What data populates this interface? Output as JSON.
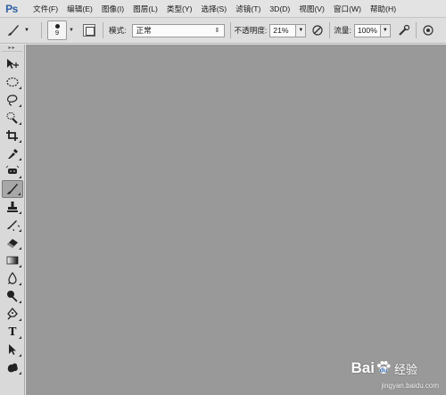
{
  "app": {
    "logo": "Ps"
  },
  "menubar": {
    "items": [
      {
        "label": "文件(F)"
      },
      {
        "label": "编辑(E)"
      },
      {
        "label": "图像(I)"
      },
      {
        "label": "图层(L)"
      },
      {
        "label": "类型(Y)"
      },
      {
        "label": "选择(S)"
      },
      {
        "label": "滤镜(T)"
      },
      {
        "label": "3D(D)"
      },
      {
        "label": "视图(V)"
      },
      {
        "label": "窗口(W)"
      },
      {
        "label": "帮助(H)"
      }
    ]
  },
  "options": {
    "brush_size": "9",
    "mode_label": "模式:",
    "mode_value": "正常",
    "opacity_label": "不透明度:",
    "opacity_value": "21%",
    "flow_label": "流量:",
    "flow_value": "100%"
  },
  "toolbox": {
    "tools": [
      {
        "name": "move-tool",
        "icon": "move-icon"
      },
      {
        "name": "marquee-tool",
        "icon": "ellipse-marquee-icon"
      },
      {
        "name": "lasso-tool",
        "icon": "lasso-icon"
      },
      {
        "name": "quick-select-tool",
        "icon": "quick-select-icon"
      },
      {
        "name": "crop-tool",
        "icon": "crop-icon"
      },
      {
        "name": "eyedropper-tool",
        "icon": "eyedropper-icon"
      },
      {
        "name": "spot-healing-tool",
        "icon": "spot-healing-icon"
      },
      {
        "name": "brush-tool",
        "icon": "brush-icon",
        "active": true
      },
      {
        "name": "clone-stamp-tool",
        "icon": "clone-stamp-icon"
      },
      {
        "name": "history-brush-tool",
        "icon": "history-brush-icon"
      },
      {
        "name": "eraser-tool",
        "icon": "eraser-icon"
      },
      {
        "name": "gradient-tool",
        "icon": "gradient-icon"
      },
      {
        "name": "blur-tool",
        "icon": "blur-icon"
      },
      {
        "name": "dodge-tool",
        "icon": "dodge-icon"
      },
      {
        "name": "pen-tool",
        "icon": "pen-icon"
      },
      {
        "name": "type-tool",
        "icon": "type-icon",
        "glyph": "T"
      },
      {
        "name": "path-select-tool",
        "icon": "path-select-icon"
      },
      {
        "name": "shape-tool",
        "icon": "shape-icon"
      }
    ]
  },
  "watermark": {
    "brand": "Bai",
    "brand_suffix": "经验",
    "url": "jingyan.baidu.com"
  },
  "colors": {
    "menubar_bg": "#e3e3e3",
    "options_bg": "#dedede",
    "toolbox_bg": "#d9d9d9",
    "canvas_bg": "#999999",
    "logo": "#2d5fa3"
  }
}
